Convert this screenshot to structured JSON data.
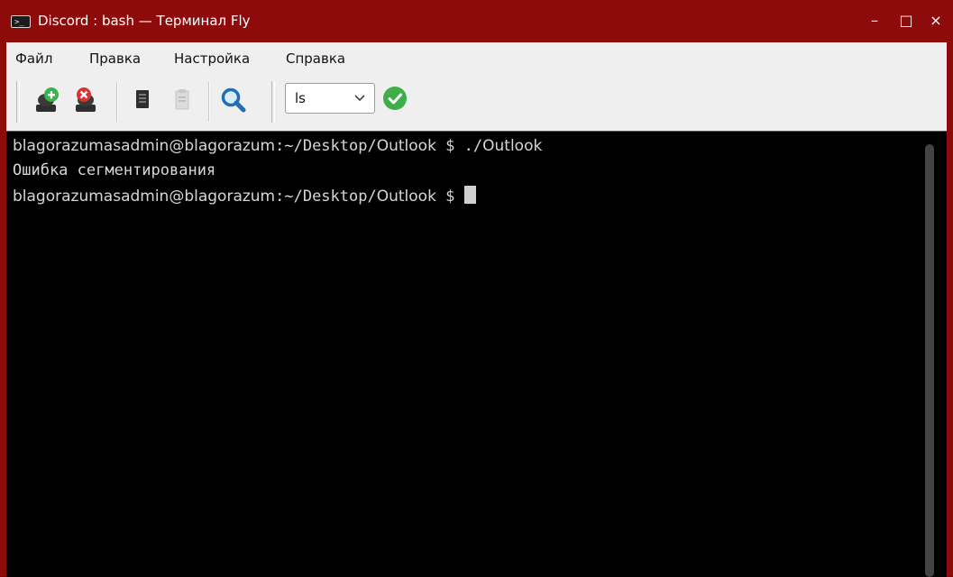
{
  "window": {
    "title": "Discord : bash — Терминал Fly",
    "controls": {
      "minimize": "–",
      "maximize": "□",
      "close": "×"
    },
    "icon": "terminal-icon"
  },
  "menu": {
    "items": [
      "Файл",
      "Правка",
      "Настройка",
      "Справка"
    ]
  },
  "toolbar": {
    "icons": [
      "new-tab-icon",
      "close-tab-icon",
      "copy-icon",
      "paste-icon",
      "search-icon"
    ],
    "command_select_value": "ls",
    "run_icon": "check-icon"
  },
  "terminal": {
    "lines": [
      {
        "user_host": "blagorazumasadmin@blagorazum",
        "path": ":~/Desktop/",
        "dir": "Outlook",
        "prompt": " $ ",
        "cmd_prefix": "./",
        "cmd": "Outlook"
      },
      {
        "text": "Ошибка сегментирования"
      },
      {
        "user_host": "blagorazumasadmin@blagorazum",
        "path": ":~/Desktop/",
        "dir": "Outlook",
        "prompt": " $ "
      }
    ]
  },
  "colors": {
    "titlebar": "#8e0b0b",
    "terminal_bg": "#000000",
    "terminal_fg": "#d6d6d6",
    "accent_green": "#3fae49"
  }
}
